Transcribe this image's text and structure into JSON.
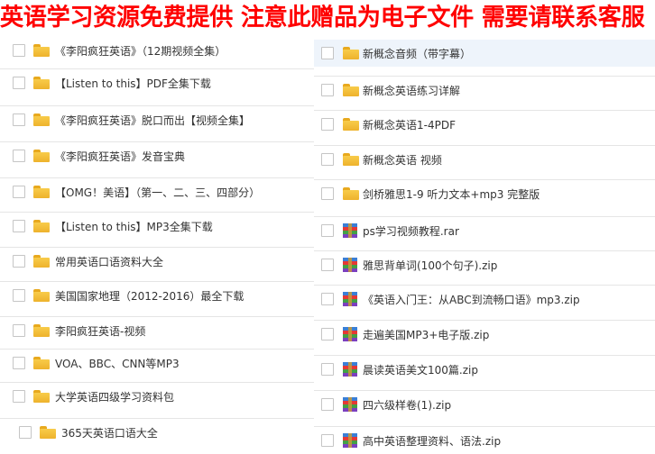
{
  "banner": {
    "text": "英语学习资源免费提供 注意此赠品为电子文件 需要请联系客服"
  },
  "left_items": [
    {
      "label": "《李阳疯狂英语》（12期视频全集）",
      "type": "folder"
    },
    {
      "label": "【Listen to this】PDF全集下载",
      "type": "folder"
    },
    {
      "label": "《李阳疯狂英语》脱口而出【视频全集】",
      "type": "folder"
    },
    {
      "label": "《李阳疯狂英语》发音宝典",
      "type": "folder"
    },
    {
      "label": "【OMG！美语】（第一、二、三、四部分）",
      "type": "folder"
    },
    {
      "label": "【Listen to this】MP3全集下载",
      "type": "folder"
    },
    {
      "label": "常用英语口语资料大全",
      "type": "folder"
    },
    {
      "label": "美国国家地理（2012-2016）最全下载",
      "type": "folder"
    },
    {
      "label": "李阳疯狂英语-视频",
      "type": "folder"
    },
    {
      "label": "VOA、BBC、CNN等MP3",
      "type": "folder"
    },
    {
      "label": "大学英语四级学习资料包",
      "type": "folder"
    },
    {
      "label": "365天英语口语大全",
      "type": "folder"
    }
  ],
  "right_items": [
    {
      "label": "新概念音频（带字幕）",
      "type": "folder"
    },
    {
      "label": "新概念英语练习详解",
      "type": "folder"
    },
    {
      "label": "新概念英语1-4PDF",
      "type": "folder"
    },
    {
      "label": "新概念英语 视频",
      "type": "folder"
    },
    {
      "label": "剑桥雅思1-9 听力文本+mp3 完整版",
      "type": "folder"
    },
    {
      "label": "ps学习视频教程.rar",
      "type": "zip"
    },
    {
      "label": "雅思背单词(100个句子).zip",
      "type": "zip"
    },
    {
      "label": "《英语入门王：从ABC到流畅口语》mp3.zip",
      "type": "zip"
    },
    {
      "label": "走遍美国MP3+电子版.zip",
      "type": "zip"
    },
    {
      "label": "晨读英语美文100篇.zip",
      "type": "zip"
    },
    {
      "label": "四六级样卷(1).zip",
      "type": "zip"
    },
    {
      "label": "高中英语整理资料、语法.zip",
      "type": "zip"
    }
  ],
  "colors": {
    "banner": "#ff0000",
    "folder": "#f3bf3a",
    "highlight": "#eef4fb"
  }
}
